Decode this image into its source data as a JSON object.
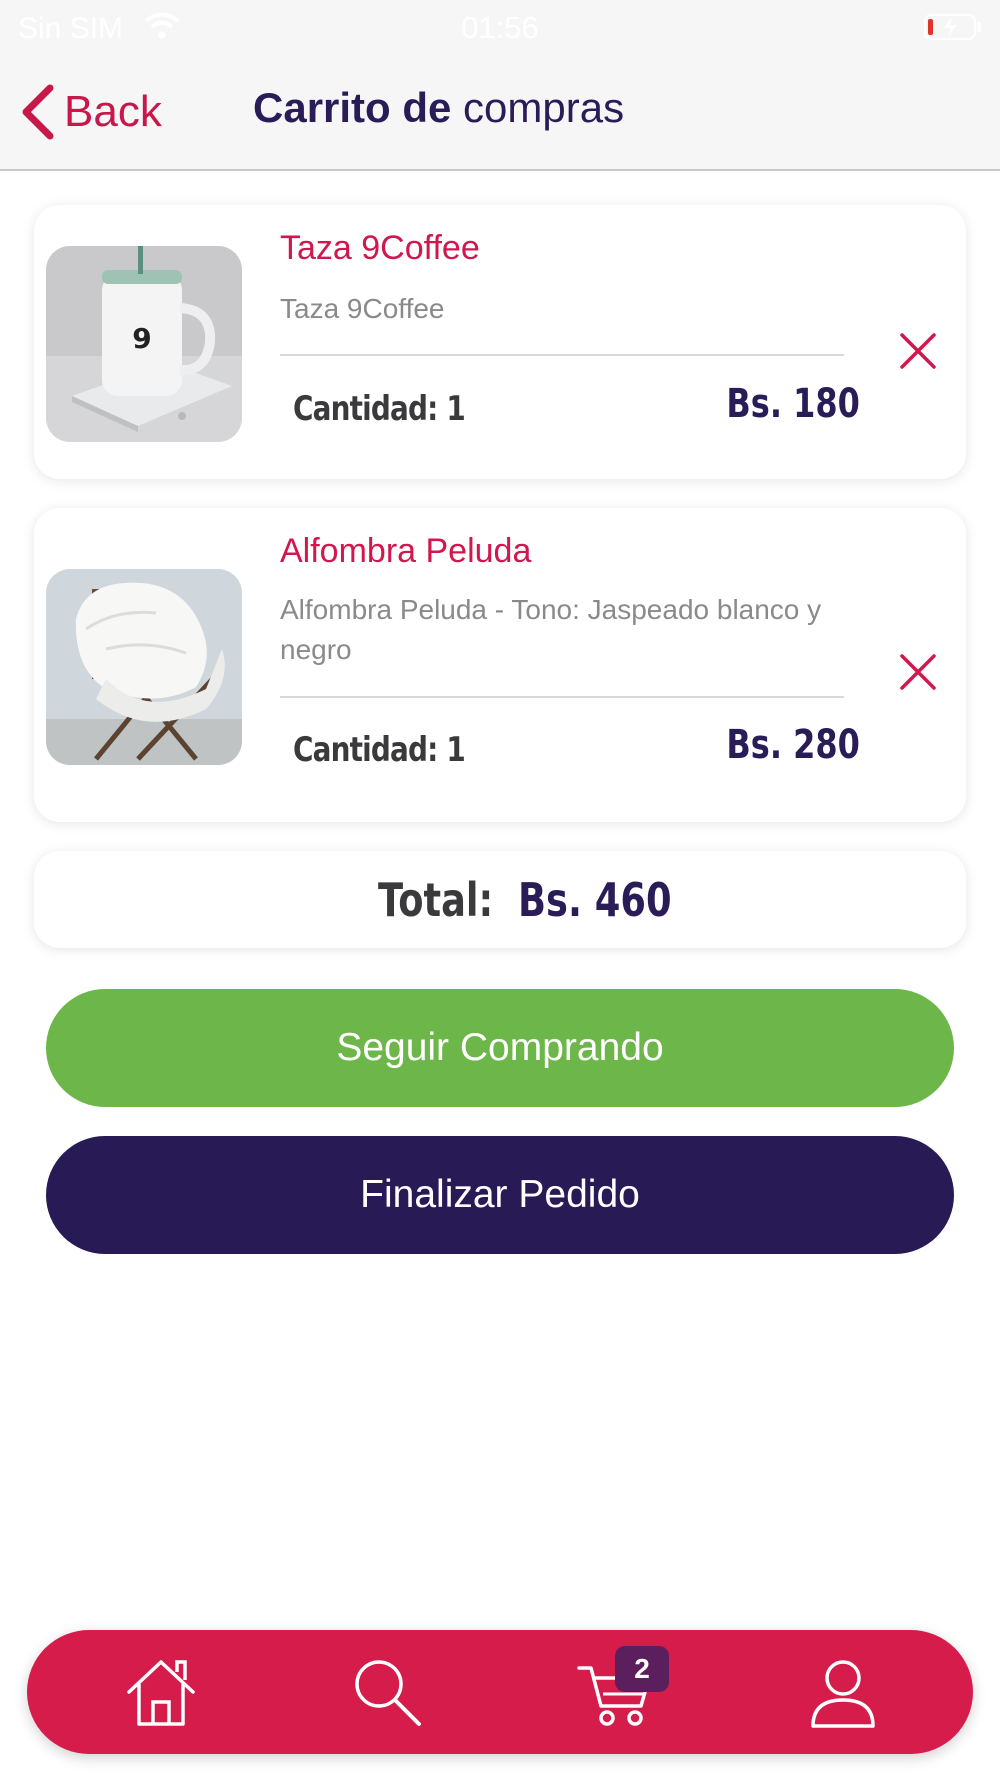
{
  "status_bar": {
    "carrier": "Sin SIM",
    "time": "01:56"
  },
  "nav": {
    "back_label": "Back",
    "title_bold": "Carrito de",
    "title_rest": " compras"
  },
  "cart": {
    "items": [
      {
        "name": "Taza 9Coffee",
        "description": "Taza 9Coffee",
        "quantity": "Cantidad: 1",
        "price": "Bs. 180"
      },
      {
        "name": "Alfombra Peluda",
        "description": "Alfombra Peluda - Tono: Jaspeado blanco y negro",
        "quantity": "Cantidad: 1",
        "price": "Bs. 280"
      }
    ],
    "total_label": "Total:",
    "total_value": "Bs. 460"
  },
  "actions": {
    "continue_label": "Seguir Comprando",
    "finish_label": "Finalizar Pedido"
  },
  "tabbar": {
    "items": [
      "home-icon",
      "search-icon",
      "cart-icon",
      "user-icon"
    ],
    "cart_badge": "2"
  },
  "colors": {
    "accent": "#d51c4b",
    "primary": "#281a55",
    "success": "#6db74a"
  }
}
